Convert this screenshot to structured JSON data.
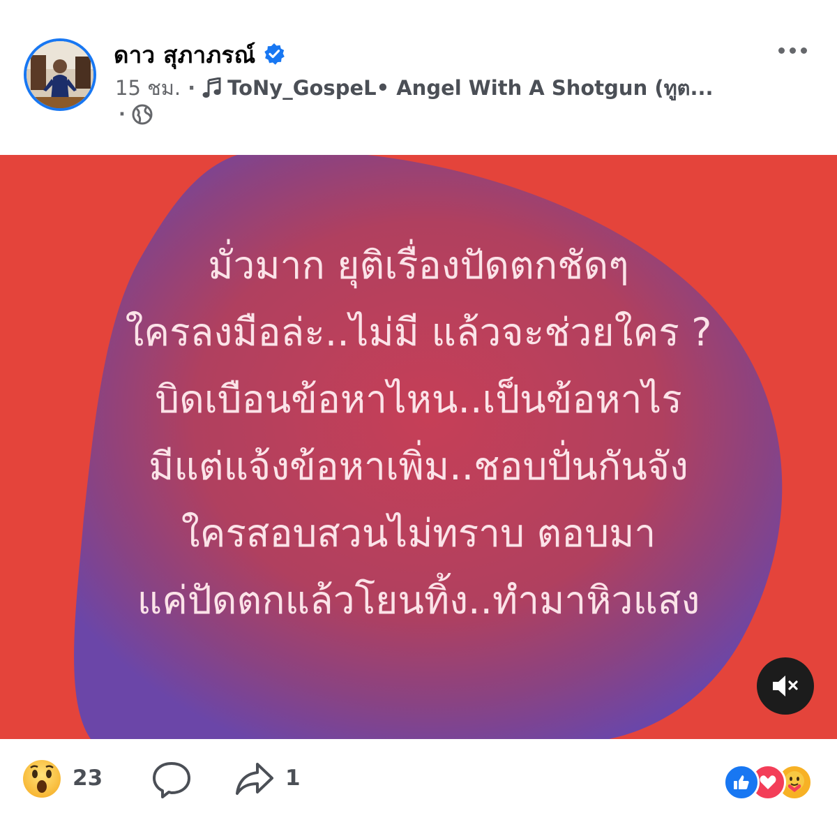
{
  "post": {
    "author": "ดาว สุภาภรณ์",
    "verified": true,
    "time": "15 ชม.",
    "separator": "·",
    "music_artist": "ToNy_GospeL",
    "music_song": "• Angel With A Shotgun (ทูต...",
    "privacy_separator": "·",
    "privacy_icon": "globe-icon",
    "text_lines": [
      "มั่วมาก ยุติเรื่องปัดตกชัดๆ",
      "ใครลงมือล่ะ..ไม่มี แล้วจะช่วยใคร ?",
      "บิดเบือนข้อหาไหน..เป็นข้อหาไร",
      "มีแต่แจ้งข้อหาเพิ่ม..ชอบปั่นกันจัง",
      "ใครสอบสวนไม่ทราบ ตอบมา",
      "แค่ปัดตกแล้วโยนทิ้ง..ทำมาหิวแสง"
    ],
    "background_color": "#e4443b",
    "blob_color": "#7a3f8f"
  },
  "footer": {
    "reaction_count": "23",
    "share_count": "1",
    "reaction_icons": [
      "like-icon",
      "love-icon",
      "care-icon"
    ]
  },
  "colors": {
    "accent": "#1877f2",
    "meta_text": "#65676b"
  }
}
